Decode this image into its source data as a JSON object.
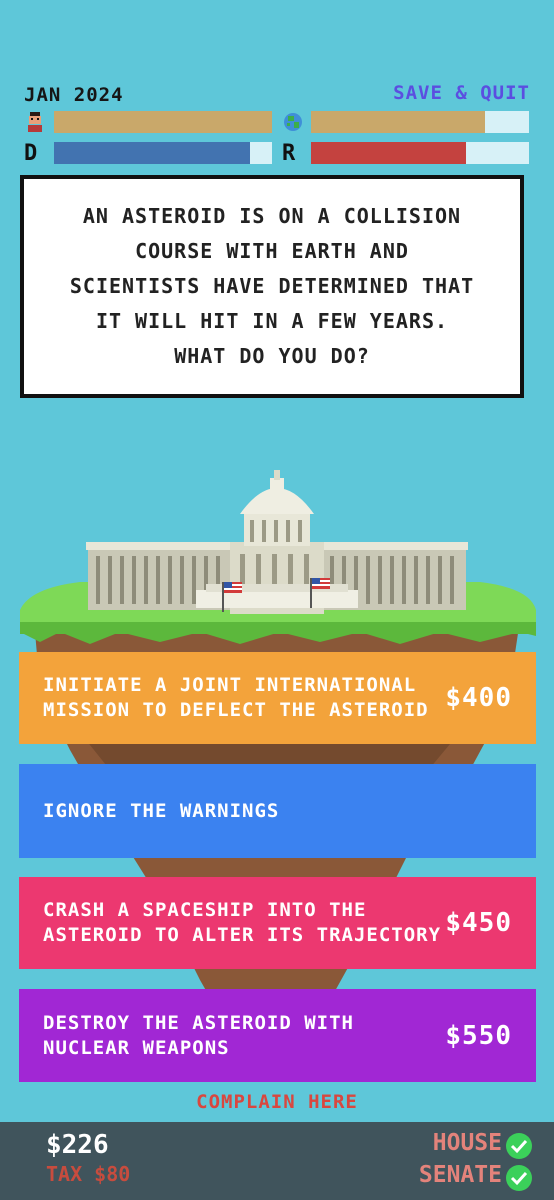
{
  "header": {
    "date": "JAN 2024",
    "save_quit": "SAVE & QUIT"
  },
  "meters": {
    "people": {
      "icon": "person-icon",
      "level": 1.0,
      "color": "#c9a86a"
    },
    "earth": {
      "icon": "globe-icon",
      "level": 0.8,
      "color": "#c9a86a"
    },
    "democrats": {
      "label": "D",
      "level": 0.9,
      "color": "#4273b0"
    },
    "republicans": {
      "label": "R",
      "level": 0.71,
      "color": "#c4423f"
    }
  },
  "question": "An asteroid is on a collision course with Earth and scientists have determined that it will hit in a few years. What do you do?",
  "choices": [
    {
      "text": "Initiate a joint international mission to deflect the asteroid",
      "price": "$400",
      "color": "#f3a33b"
    },
    {
      "text": "Ignore the warnings",
      "price": "",
      "color": "#3b82f0"
    },
    {
      "text": "Crash a spaceship into the asteroid to alter its trajectory",
      "price": "$450",
      "color": "#ec3870"
    },
    {
      "text": "Destroy the asteroid with nuclear weapons",
      "price": "$550",
      "color": "#a127d4"
    }
  ],
  "complain": "COMPLAIN HERE",
  "footer": {
    "money": "$226",
    "tax": "TAX $80",
    "house": "HOUSE",
    "senate": "SENATE"
  }
}
